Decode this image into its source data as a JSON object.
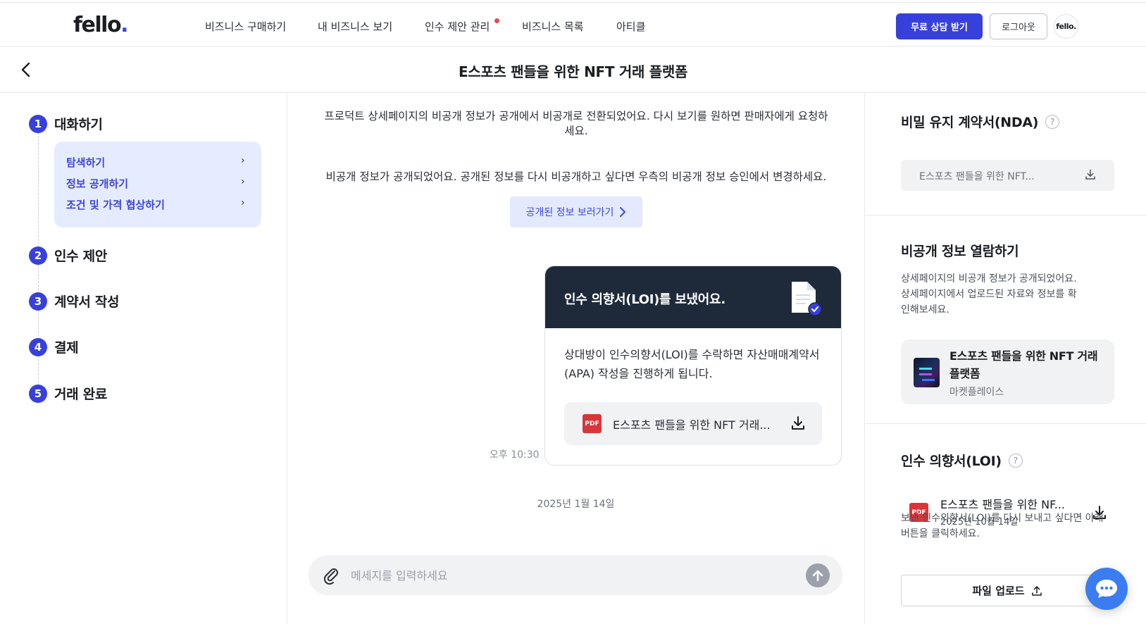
{
  "header": {
    "logo": "fello",
    "logo_dot": ".",
    "nav": [
      {
        "label": "비즈니스 구매하기"
      },
      {
        "label": "내 비즈니스 보기"
      },
      {
        "label": "인수 제안 관리"
      },
      {
        "label": "비즈니스 목록"
      },
      {
        "label": "아티클"
      }
    ],
    "cta_label": "무료 상담 받기",
    "logout_label": "로그아웃",
    "avatar_text": "fello."
  },
  "page": {
    "title": "E스포츠 팬들을 위한 NFT 거래 플랫폼"
  },
  "steps": {
    "items": [
      {
        "num": "1",
        "label": "대화하기"
      },
      {
        "num": "2",
        "label": "인수 제안"
      },
      {
        "num": "3",
        "label": "계약서 작성"
      },
      {
        "num": "4",
        "label": "결제"
      },
      {
        "num": "5",
        "label": "거래 완료"
      }
    ],
    "substeps": [
      {
        "label": "탐색하기",
        "chevron": "›"
      },
      {
        "label": "정보 공개하기",
        "chevron": "›"
      },
      {
        "label": "조건 및 가격 협상하기",
        "chevron": "›"
      }
    ]
  },
  "chat": {
    "notice_private": "프로덕트 상세페이지의 비공개 정보가 공개에서 비공개로 전환되었어요. 다시 보기를 원하면 판매자에게 요청하세요.",
    "notice_public": "비공개 정보가 공개되었어요. 공개된 정보를 다시 비공개하고 싶다면 우측의 비공개 정보 승인에서 변경하세요.",
    "view_button_label": "공개된 정보 보러가기",
    "message": {
      "title": "인수 의향서(LOI)를 보냈어요.",
      "body": "상대방이 인수의향서(LOI)를 수락하면 자산매매계약서(APA) 작성을 진행하게 됩니다.",
      "file_badge": "PDF",
      "file_name": "E스포츠 팬들을 위한 NFT 거래...",
      "time": "오후 10:30"
    },
    "date_separator": "2025년 1월 14일",
    "composer_placeholder": "메세지를 입력하세요"
  },
  "sidebar": {
    "nda": {
      "title": "비밀 유지 계약서(NDA)",
      "help": "?",
      "file_name": "E스포츠 팬들을 위한 NFT..."
    },
    "private_info": {
      "title": "비공개 정보 열람하기",
      "desc": "상세페이지의 비공개 정보가 공개되었어요. 상세페이지에서 업로드된 자료와 정보를 확인해보세요.",
      "product_name": "E스포츠 팬들을 위한 NFT 거래 플랫폼",
      "product_category": "마켓플레이스"
    },
    "loi": {
      "title": "인수 의향서(LOI)",
      "help": "?",
      "file_badge": "PDF",
      "file_name": "E스포츠 팬들을 위한 NF...",
      "file_date": "2025년 10월 14일",
      "desc": "보낸 인수의향서(LOI)를 다시 보내고 싶다면 아래 버튼을 클릭하세요.",
      "upload_label": "파일 업로드"
    }
  },
  "colors": {
    "primary": "#3840dc",
    "message_header": "#1e2a3a",
    "pdf_red": "#d9363a",
    "notification_dot": "#f0454c",
    "chat_fab": "#3b7df0"
  }
}
